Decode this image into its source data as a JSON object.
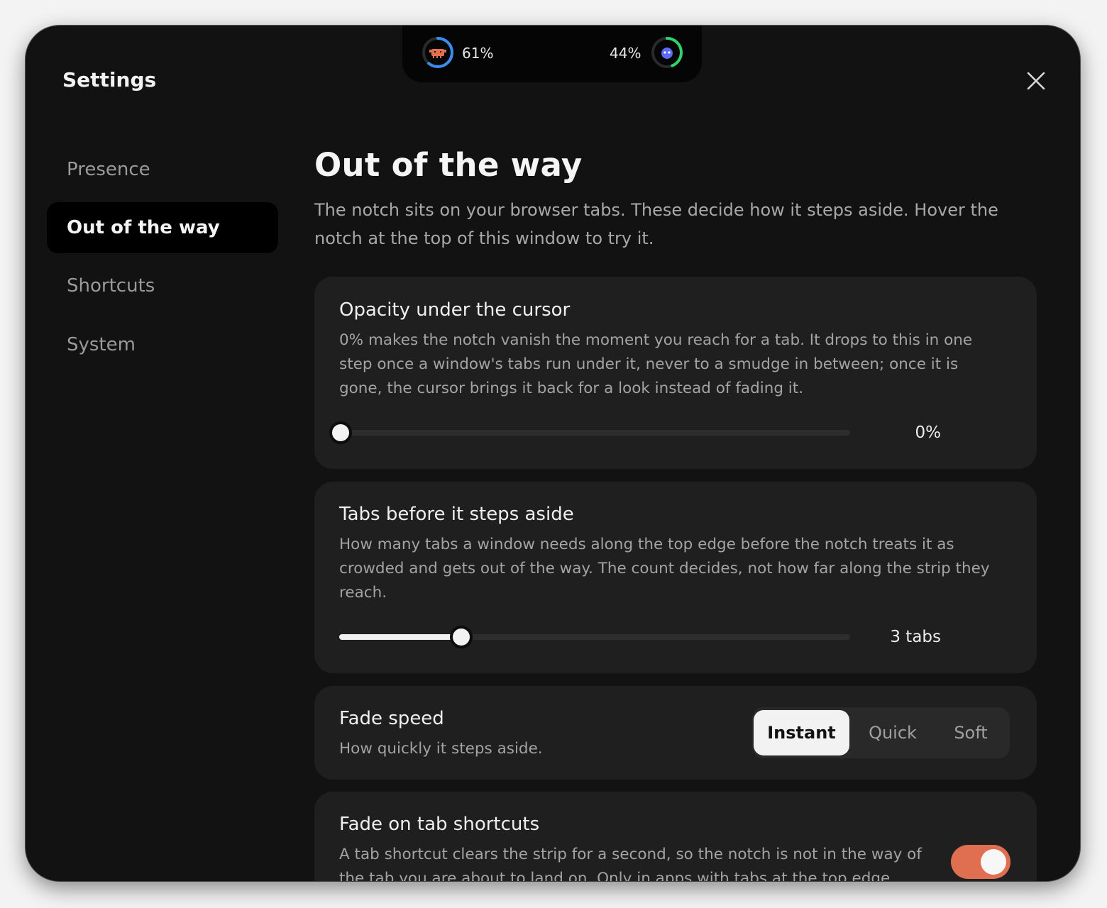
{
  "notch": {
    "left_meter": {
      "icon": "crab-icon",
      "percent": 61,
      "label": "61%",
      "ring_color": "#3b8cf0",
      "icon_color": "#e0704f"
    },
    "right_meter": {
      "icon": "blob-icon",
      "percent": 44,
      "label": "44%",
      "ring_color": "#2fd36a",
      "icon_color": "#5b6cf0"
    }
  },
  "window": {
    "title": "Settings"
  },
  "sidebar": {
    "items": [
      {
        "label": "Presence",
        "active": false
      },
      {
        "label": "Out of the way",
        "active": true
      },
      {
        "label": "Shortcuts",
        "active": false
      },
      {
        "label": "System",
        "active": false
      }
    ]
  },
  "page": {
    "heading": "Out of the way",
    "subtitle": "The notch sits on your browser tabs. These decide how it steps aside. Hover the notch at the top of this window to try it."
  },
  "settings": {
    "opacity": {
      "title": "Opacity under the cursor",
      "description": "0% makes the notch vanish the moment you reach for a tab. It drops to this in one step once a window's tabs run under it, never to a smudge in between; once it is gone, the cursor brings it back for a look instead of fading it.",
      "value_fraction": 0,
      "value_label": "0%"
    },
    "tabs": {
      "title": "Tabs before it steps aside",
      "description": "How many tabs a window needs along the top edge before the notch treats it as crowded and gets out of the way. The count decides, not how far along the strip they reach.",
      "value_fraction": 0.236,
      "value_label": "3 tabs"
    },
    "fade_speed": {
      "title": "Fade speed",
      "description": "How quickly it steps aside.",
      "options": [
        "Instant",
        "Quick",
        "Soft"
      ],
      "selected": "Instant"
    },
    "fade_shortcuts": {
      "title": "Fade on tab shortcuts",
      "description": "A tab shortcut clears the strip for a second, so the notch is not in the way of the tab you are about to land on. Only in apps with tabs at the top edge.",
      "enabled": true,
      "accent": "#e06f52"
    }
  }
}
